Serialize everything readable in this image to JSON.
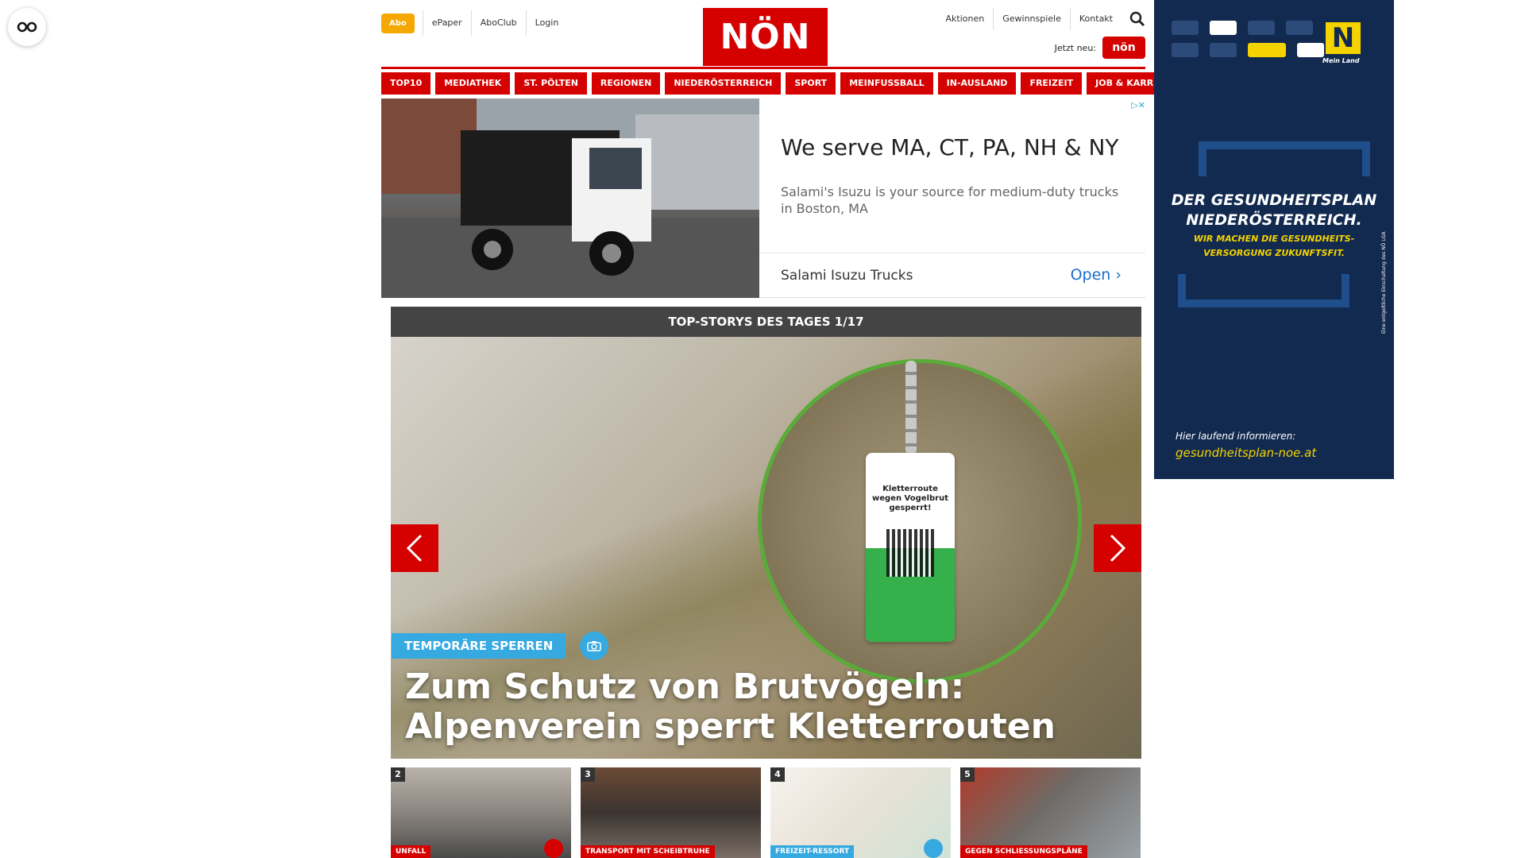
{
  "header": {
    "abo_label": "Abo",
    "links_left": [
      "ePaper",
      "AboClub",
      "Login"
    ],
    "logo_text": "NÖN",
    "links_right": [
      "Aktionen",
      "Gewinnspiele",
      "Kontakt"
    ],
    "jetzt_label": "Jetzt neu:",
    "jetzt_badge": "nön"
  },
  "nav": {
    "items": [
      "TOP10",
      "MEDIATHEK",
      "ST. PÖLTEN",
      "REGIONEN",
      "NIEDERÖSTERREICH",
      "SPORT",
      "MEINFUSSBALL",
      "IN-AUSLAND",
      "FREIZEIT",
      "JOB & KARRIERE"
    ]
  },
  "ad": {
    "headline": "We serve MA, CT, PA, NH & NY",
    "description": "Salami's Isuzu is your source for medium-duty trucks in Boston, MA",
    "brand": "Salami Isuzu Trucks",
    "cta": "Open"
  },
  "stories": {
    "header": "TOP-STORYS DES TAGES 1/17",
    "hero": {
      "kicker": "TEMPORÄRE SPERREN",
      "title": "Zum Schutz von Brutvögeln: Alpenverein sperrt Kletterrouten",
      "sign_text": "Kletterroute wegen Vogelbrut gesperrt!"
    },
    "thumbs": [
      {
        "num": "2",
        "tag": "UNFALL",
        "tag_color": "#d50000"
      },
      {
        "num": "3",
        "tag": "TRANSPORT MIT SCHEIBTRUHE",
        "tag_color": "#d50000"
      },
      {
        "num": "4",
        "tag": "FREIZEIT-RESSORT",
        "tag_color": "#36a9e1"
      },
      {
        "num": "5",
        "tag": "GEGEN SCHLIESSUNGSPLÄNE",
        "tag_color": "#d50000"
      }
    ]
  },
  "side_ad": {
    "brand": "Mein Land",
    "title_line1": "DER GESUNDHEITSPLAN",
    "title_line2": "NIEDERÖSTERREICH.",
    "sub_line1": "WIR MACHEN DIE GESUNDHEITS-",
    "sub_line2": "VERSORGUNG ZUKUNFTSFIT.",
    "info": "Hier laufend informieren:",
    "url": "gesundheitsplan-noe.at",
    "disclaimer": "Eine entgeltliche Einschaltung des NÖ LGA"
  },
  "colors": {
    "brand_red": "#d50000",
    "accent_blue": "#36a9e1",
    "abo_orange": "#f5a800",
    "side_navy": "#122a4f",
    "side_yellow": "#f5d300"
  }
}
